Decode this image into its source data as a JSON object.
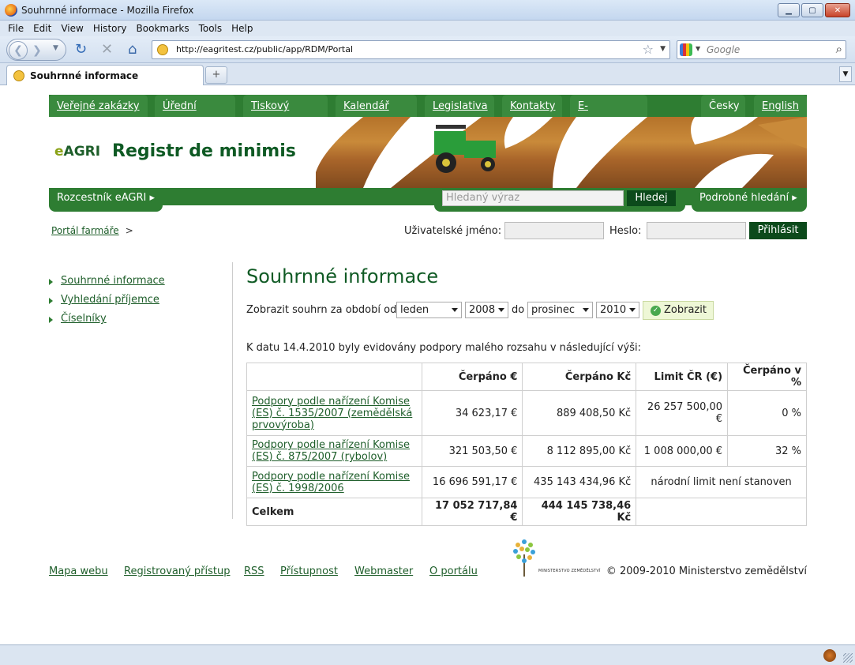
{
  "browser": {
    "window_title": "Souhrnné informace - Mozilla Firefox",
    "menu": [
      "File",
      "Edit",
      "View",
      "History",
      "Bookmarks",
      "Tools",
      "Help"
    ],
    "url": "http://eagritest.cz/public/app/RDM/Portal",
    "search_placeholder": "Google",
    "tab_title": "Souhrnné informace",
    "newtab_label": "+"
  },
  "topnav": {
    "items": [
      "Veřejné zakázky",
      "Úřední desky",
      "Tiskový servis",
      "Kalendář akcí",
      "Legislativa",
      "Kontakty",
      "E-podatelna"
    ],
    "lang_cz": "Česky",
    "lang_en": "English"
  },
  "banner": {
    "logo_e": "e",
    "logo_agri": "AGRI",
    "title": "Registr de minimis"
  },
  "subnav": {
    "rozcestnik": "Rozcestník eAGRI ▸",
    "search_placeholder": "Hledaný výraz",
    "search_button": "Hledej",
    "advanced": "Podrobné hledání ▸"
  },
  "breadcrumb": {
    "home": "Portál farmáře",
    "sep": ">"
  },
  "login": {
    "user_label": "Uživatelské jméno:",
    "pass_label": "Heslo:",
    "button": "Přihlásit"
  },
  "leftnav": [
    "Souhrnné informace",
    "Vyhledání příjemce",
    "Číselníky"
  ],
  "main": {
    "heading": "Souhrnné informace",
    "filter_label": "Zobrazit souhrn za období od",
    "from_month": "leden",
    "from_year": "2008",
    "to_label": "do",
    "to_month": "prosinec",
    "to_year": "2010",
    "show_button": "Zobrazit",
    "intro": "K datu 14.4.2010 byly evidovány podpory malého rozsahu v následující výši:"
  },
  "table": {
    "headers": [
      "",
      "Čerpáno €",
      "Čerpáno Kč",
      "Limit ČR (€)",
      "Čerpáno v %"
    ],
    "rows": [
      {
        "name": "Podpory podle nařízení Komise (ES) č. 1535/2007 (zemědělská prvovýroba)",
        "eur": "34 623,17 €",
        "czk": "889 408,50 Kč",
        "limit": "26 257 500,00 €",
        "pct": "0 %"
      },
      {
        "name": "Podpory podle nařízení Komise (ES) č. 875/2007 (rybolov)",
        "eur": "321 503,50 €",
        "czk": "8 112 895,00 Kč",
        "limit": "1 008 000,00 €",
        "pct": "32 %"
      },
      {
        "name": "Podpory podle nařízení Komise (ES) č. 1998/2006",
        "eur": "16 696 591,17 €",
        "czk": "435 143 434,96 Kč",
        "limit_note": "národní limit není stanoven"
      }
    ],
    "total": {
      "label": "Celkem",
      "eur": "17 052 717,84 €",
      "czk": "444 145 738,46 Kč"
    }
  },
  "footer": {
    "links": [
      "Mapa webu",
      "Registrovaný přístup",
      "RSS",
      "Přístupnost",
      "Webmaster",
      "O portálu"
    ],
    "ministry_logo_text": "MINISTERSTVO ZEMĚDĚLSTVÍ",
    "copyright": "© 2009-2010 Ministerstvo zemědělství"
  }
}
